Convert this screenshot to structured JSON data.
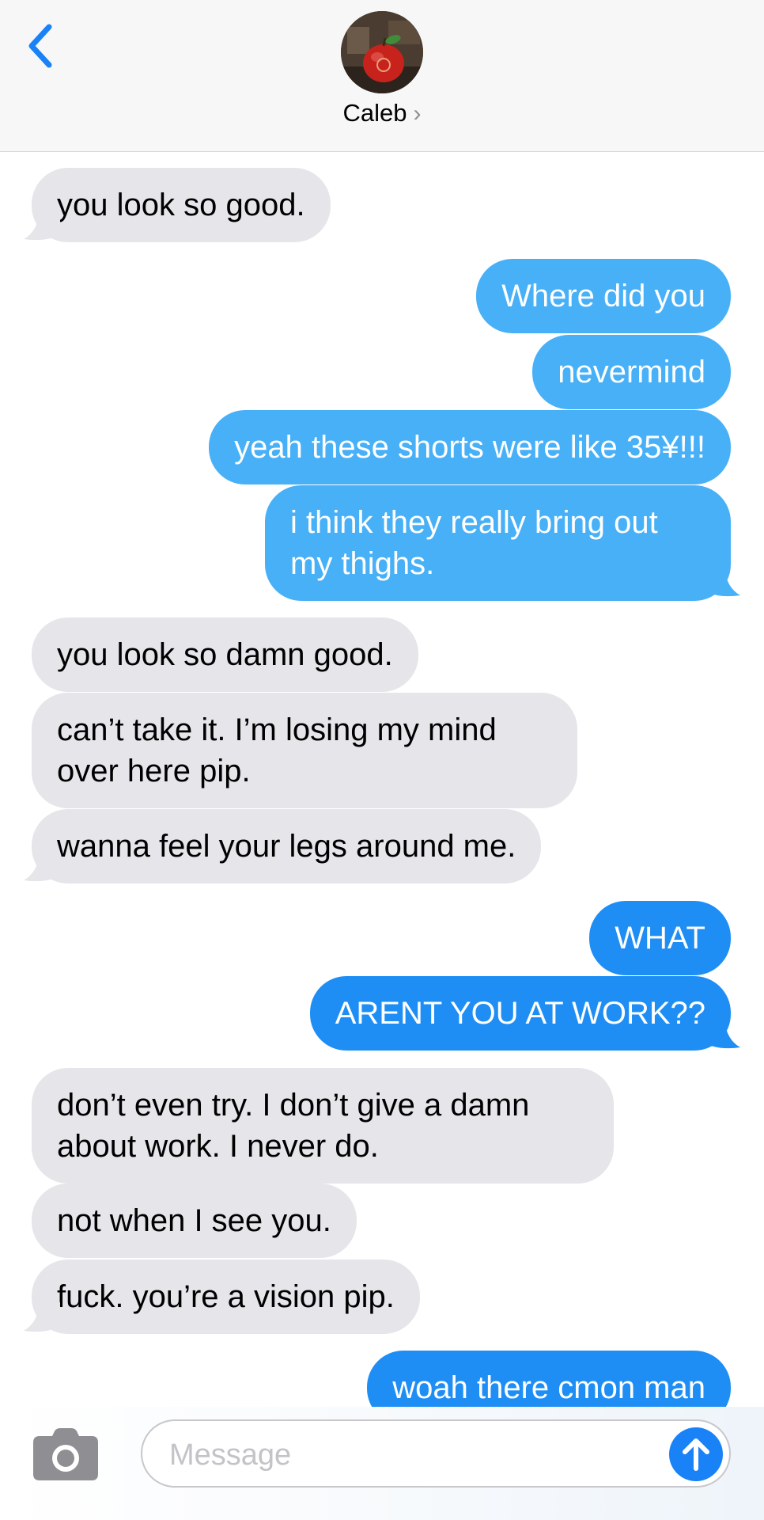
{
  "header": {
    "contact_name": "Caleb",
    "chevron": "›"
  },
  "messages": [
    {
      "side": "in",
      "text": "you look so good."
    },
    {
      "side": "out",
      "text": "Where did you"
    },
    {
      "side": "out",
      "text": "nevermind"
    },
    {
      "side": "out",
      "text": "yeah these shorts were like 35¥!!!"
    },
    {
      "side": "out",
      "text": "i think they really bring out my thighs."
    },
    {
      "side": "in",
      "text": "you look so damn good."
    },
    {
      "side": "in",
      "text": "can’t take it. I’m losing my mind over here pip."
    },
    {
      "side": "in",
      "text": "wanna feel your legs around me."
    },
    {
      "side": "out",
      "text": "WHAT"
    },
    {
      "side": "out",
      "text": "ARENT YOU AT WORK??"
    },
    {
      "side": "in",
      "text": "don’t even try. I don’t give a damn about work. I never do."
    },
    {
      "side": "in",
      "text": "not when I see you."
    },
    {
      "side": "in",
      "text": "fuck. you’re a vision pip."
    },
    {
      "side": "out",
      "text": "woah there cmon man"
    }
  ],
  "input": {
    "placeholder": "Message"
  },
  "icons": {
    "back": "chevron-left-icon",
    "camera": "camera-icon",
    "send": "arrow-up-icon"
  },
  "colors": {
    "accent": "#1a82f7",
    "outgoing_bubble": "#1e8ef5",
    "incoming_bubble": "#e5e5ea"
  }
}
